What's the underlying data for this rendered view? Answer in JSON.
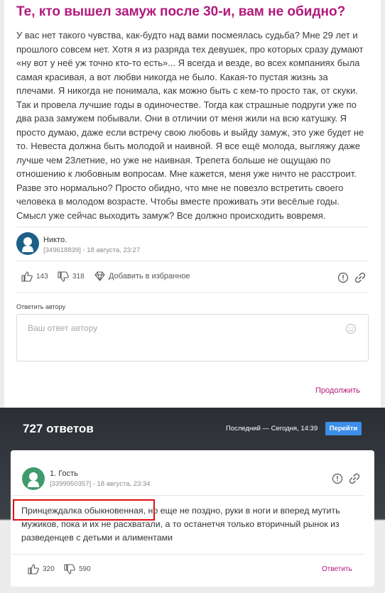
{
  "topic": {
    "title": "Те, кто вышел замуж после 30-и, вам не обидно?",
    "body": "У вас нет такого чувства, как-будто над вами посмеялась судьба? Мне 29 лет и\nпрошлого совсем нет. Хотя я из разряда тех девушек, про которых сразу думают\n«ну вот у неё уж точно кто-то есть»... Я всегда и везде, во всех компаниях была\nсамая красивая, а вот любви никогда не было. Какая-то пустая жизнь за\nплечами. Я никогда не понимала, как можно быть с кем-то просто так, от скуки.\nТак и провела лучшие годы в одиночестве. Тогда как страшные подруги уже по\nдва раза замужем побывали. Они в отличии от меня жили на всю катушку. Я\nпросто думаю, даже если встречу свою любовь и выйду замуж, это уже будет не\nто. Невеста должна быть молодой и наивной. Я все ещё молода, выгляжу даже\nлучше чем 23летние, но уже не наивная. Трепета больше не ощущаю по\nотношению к любовным вопросам. Мне кажется, меня уже ничто не расстроит.\nРазве это нормально? Просто обидно, что мне не повезло встретить своего\nчеловека в молодом возрасте. Чтобы вместе проживать эти весёлые годы.\nСмысл уже сейчас выходить замуж? Все должно происходить вовремя.",
    "author": {
      "name": "Никто.",
      "meta": "[349618839] - 18 августа, 23:27",
      "avatar_color": "#1d5f86"
    },
    "likes": "143",
    "dislikes": "318",
    "favorite_label": "Добавить в избранное",
    "reply_label": "Ответить автору",
    "reply_placeholder": "Ваш ответ автору",
    "continue_label": "Продолжить"
  },
  "answers_bar": {
    "count_label": "727 ответов",
    "last_label": "Последний — Сегодня, 14:39",
    "go_label": "Перейти"
  },
  "answer": {
    "author_name": "1. Гость",
    "author_meta": "[3399950357] - 18 августа, 23:34",
    "avatar_color": "#3f9a6c",
    "text": "Принцеждалка обыкновенная, но еще не поздно, руки в ноги и вперед мутить мужиков, пока и их не расхватали, а то останетчя только вторичный рынок из разведенцев с детьми и алиментами",
    "likes": "320",
    "dislikes": "590",
    "reply_label": "Ответить"
  },
  "colors": {
    "accent": "#b2197c",
    "button_blue": "#3c8ee8",
    "dark_band": "#2b2f35",
    "highlight": "#e01010"
  }
}
